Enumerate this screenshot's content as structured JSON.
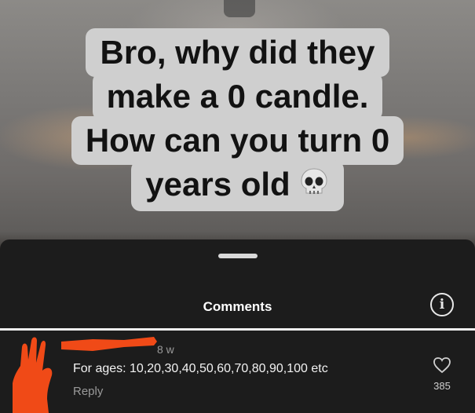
{
  "video": {
    "caption_lines": [
      "Bro, why did they",
      "make a 0 candle.",
      "How can you turn 0",
      "years old"
    ],
    "caption_emoji": "skull-icon"
  },
  "sheet": {
    "title": "Comments",
    "info_icon": "info-icon",
    "info_label": "i"
  },
  "comment": {
    "time": "8 w",
    "text": "For ages: 10,20,30,40,50,60,70,80,90,100 etc",
    "reply_label": "Reply",
    "like_count": "385",
    "like_icon": "heart-icon"
  },
  "colors": {
    "sheet_bg": "#1c1c1c",
    "redaction": "#f04a17",
    "caption_bg": "#cfcfcf"
  }
}
